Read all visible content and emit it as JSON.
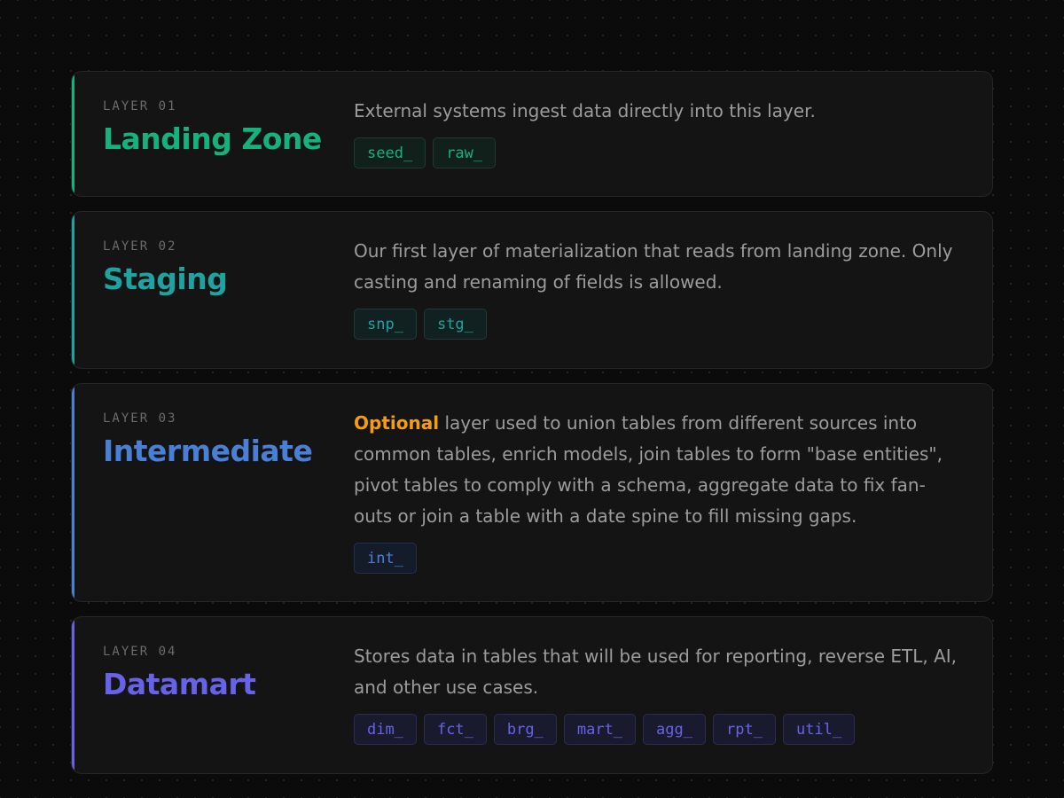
{
  "layers": [
    {
      "label": "LAYER 01",
      "title": "Landing Zone",
      "description": "External systems ingest data directly into this layer.",
      "tags": [
        "seed_",
        "raw_"
      ],
      "accent": "#16b27e"
    },
    {
      "label": "LAYER 02",
      "title": "Staging",
      "description": "Our first layer of materialization that reads from landing zone. Only casting and renaming of fields is allowed.",
      "tags": [
        "snp_",
        "stg_"
      ],
      "accent": "#1fa3a0"
    },
    {
      "label": "LAYER 03",
      "title": "Intermediate",
      "description_highlight": "Optional",
      "description": "layer used to union tables from different sources into common tables, enrich models, join tables to form \"base entities\", pivot tables to comply with a schema, aggregate data to fix fan-outs or join a table with a date spine to fill missing gaps.",
      "tags": [
        "int_"
      ],
      "accent": "#4a7fd6",
      "highlight_color": "#f59e0b"
    },
    {
      "label": "LAYER 04",
      "title": "Datamart",
      "description": "Stores data in tables that will be used for reporting, reverse ETL, AI, and other use cases.",
      "tags": [
        "dim_",
        "fct_",
        "brg_",
        "mart_",
        "agg_",
        "rpt_",
        "util_"
      ],
      "accent": "#6663e8"
    }
  ]
}
